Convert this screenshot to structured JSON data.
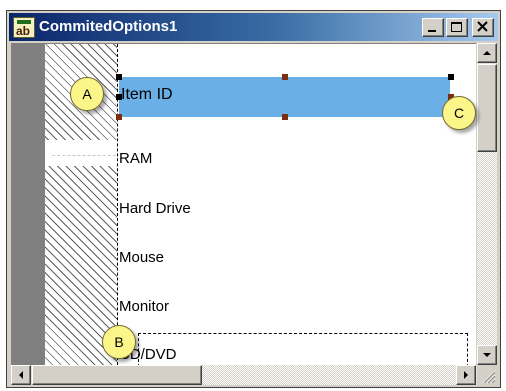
{
  "window": {
    "title": "CommitedOptions1",
    "icon": "label-tool-icon"
  },
  "fields": [
    {
      "label": "Item ID"
    },
    {
      "label": "RAM"
    },
    {
      "label": "Hard Drive"
    },
    {
      "label": "Mouse"
    },
    {
      "label": "Monitor"
    },
    {
      "label": "CD/DVD"
    }
  ],
  "callouts": {
    "a": "A",
    "b": "B",
    "c": "C"
  },
  "colors": {
    "selection": "#6ab0e6",
    "callout": "#fbf58a",
    "titlebar_start": "#0a246a",
    "titlebar_end": "#a6caf0"
  }
}
